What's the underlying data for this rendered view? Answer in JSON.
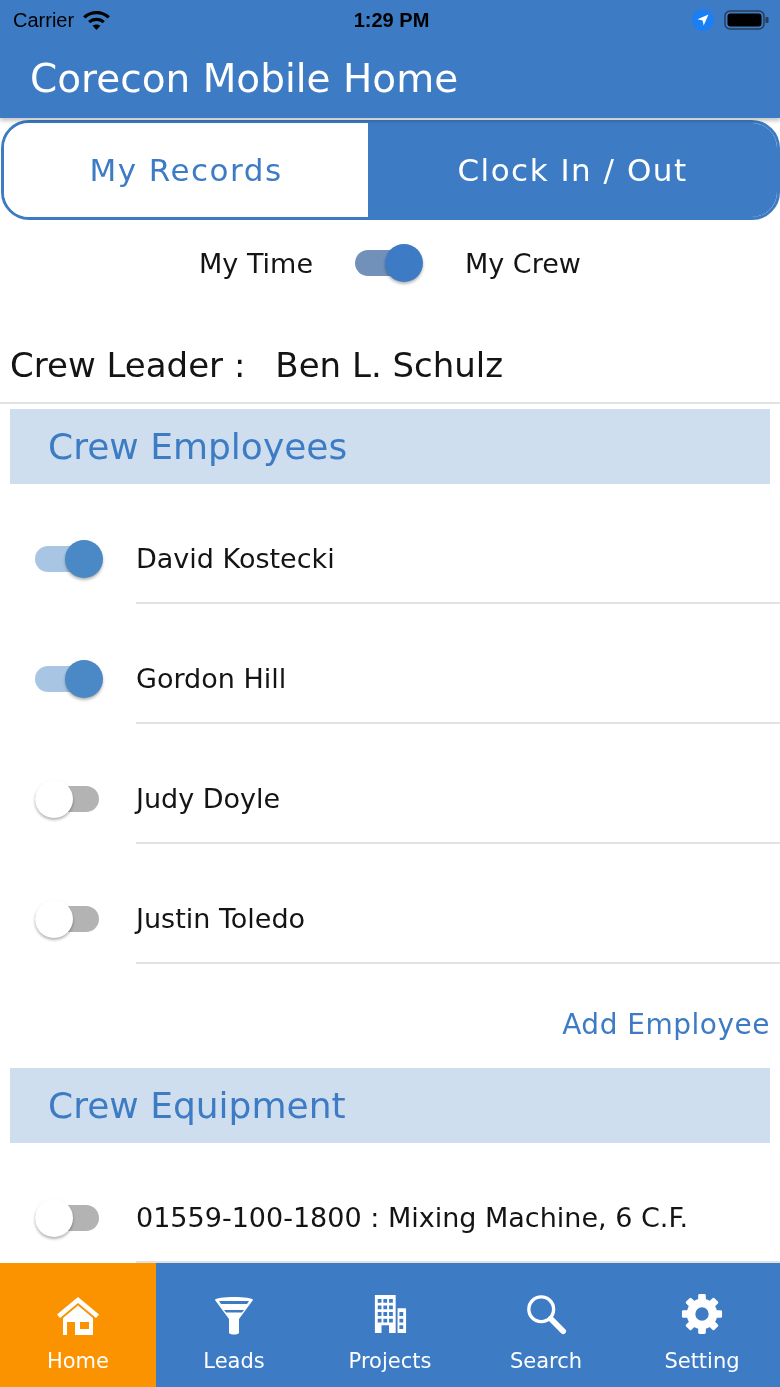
{
  "status_bar": {
    "carrier": "Carrier",
    "time": "1:29 PM"
  },
  "header": {
    "title": "Corecon Mobile Home"
  },
  "segments": [
    {
      "label": "My Records",
      "selected": true
    },
    {
      "label": "Clock In / Out",
      "selected": false
    }
  ],
  "mode_switch": {
    "left_label": "My Time",
    "right_label": "My Crew",
    "on": true
  },
  "crew_leader": {
    "label": "Crew Leader :",
    "name": "Ben L. Schulz"
  },
  "sections": [
    {
      "title": "Crew Employees",
      "items": [
        {
          "name": "David Kostecki",
          "on": true
        },
        {
          "name": "Gordon Hill",
          "on": true
        },
        {
          "name": "Judy Doyle",
          "on": false
        },
        {
          "name": "Justin Toledo",
          "on": false
        }
      ],
      "action": "Add Employee"
    },
    {
      "title": "Crew Equipment",
      "items": [
        {
          "name": "01559-100-1800 : Mixing Machine, 6 C.F.",
          "on": false
        }
      ]
    }
  ],
  "tab_bar": [
    {
      "label": "Home",
      "selected": true
    },
    {
      "label": "Leads",
      "selected": false
    },
    {
      "label": "Projects",
      "selected": false
    },
    {
      "label": "Search",
      "selected": false
    },
    {
      "label": "Setting",
      "selected": false
    }
  ]
}
